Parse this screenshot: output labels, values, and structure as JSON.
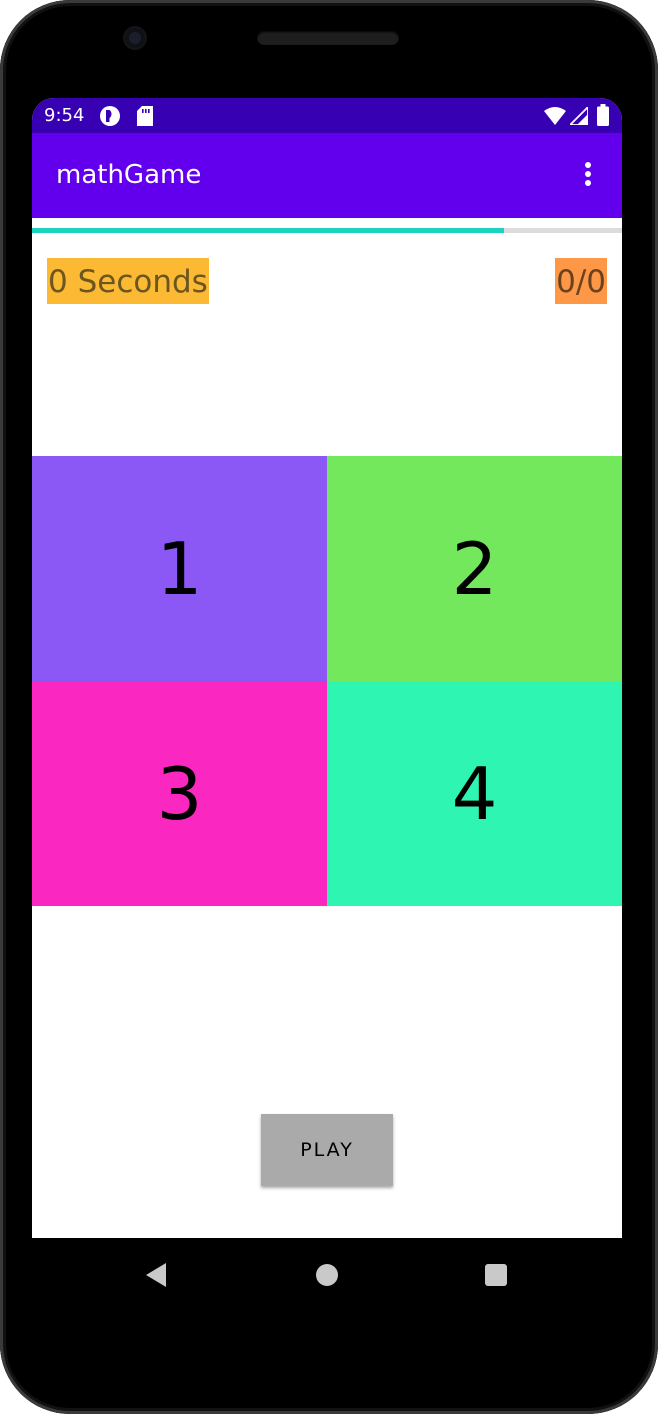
{
  "status_bar": {
    "time": "9:54",
    "left_icons": [
      "sync-app-icon",
      "sd-card-icon"
    ],
    "right_icons": [
      "wifi-icon",
      "cellular-signal-icon",
      "battery-icon"
    ]
  },
  "app_bar": {
    "title": "mathGame",
    "menu_icon": "more-vert-icon"
  },
  "progress": {
    "value_fraction": 0.8,
    "track_color": "#dcdcdc",
    "fill_color": "#1ed2c0"
  },
  "stats": {
    "timer": "0 Seconds",
    "score": "0/0",
    "timer_bg": "#fbb934",
    "score_bg": "#fe9746"
  },
  "answers": [
    {
      "label": "1",
      "color": "#8c58f5"
    },
    {
      "label": "2",
      "color": "#74e85d"
    },
    {
      "label": "3",
      "color": "#fa28c0"
    },
    {
      "label": "4",
      "color": "#2ff5b2"
    }
  ],
  "play_button": {
    "label": "PLAY"
  },
  "nav_bar": {
    "icons": [
      "back-icon",
      "home-icon",
      "recents-icon"
    ]
  },
  "colors": {
    "status_bar": "#3700b3",
    "app_bar": "#6200ee"
  }
}
